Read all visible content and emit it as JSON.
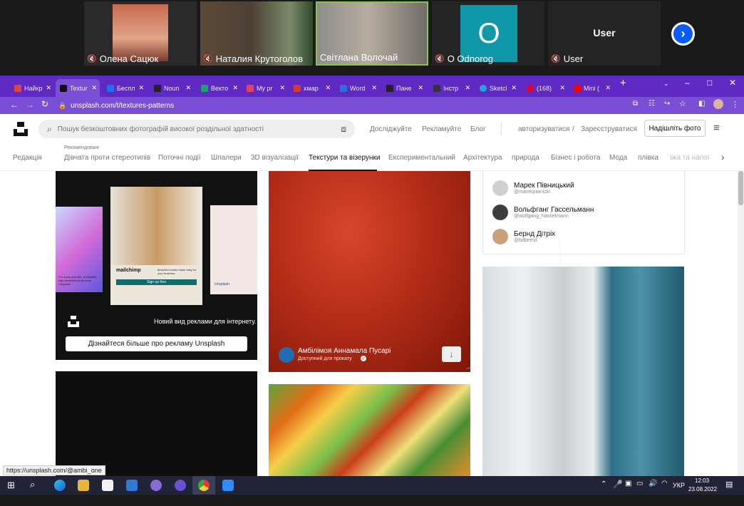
{
  "meeting": {
    "participants": [
      {
        "name": "Олена Сацюк",
        "muted": true,
        "avatar_color": "#b8543c"
      },
      {
        "name": "Наталия Крутоголов",
        "muted": true,
        "avatar_color": "#4a4035"
      },
      {
        "name": "Світлана Волочай",
        "muted": false,
        "avatar_color": "#8a8a86"
      },
      {
        "name": "O Odnorog",
        "muted": true,
        "avatar_letter": "O",
        "avatar_color": "#1098a8"
      },
      {
        "name": "User",
        "muted": true,
        "avatar_text": "User"
      }
    ]
  },
  "browser": {
    "tabs": [
      {
        "label": "Найкр",
        "favicon_color": "#e2433a"
      },
      {
        "label": "Textur",
        "favicon_color": "#111111",
        "active": true
      },
      {
        "label": "Беспл",
        "favicon_color": "#1a73e8"
      },
      {
        "label": "Noun",
        "favicon_color": "#222222"
      },
      {
        "label": "Векто",
        "favicon_color": "#1ca36b"
      },
      {
        "label": "My pr",
        "favicon_color": "#e2435b"
      },
      {
        "label": "хмар",
        "favicon_color": "#d83a2f"
      },
      {
        "label": "Word",
        "favicon_color": "#2a6fdb"
      },
      {
        "label": "Пане",
        "favicon_color": "#222222"
      },
      {
        "label": "Інстр",
        "favicon_color": "#333333"
      },
      {
        "label": "Sketcl",
        "favicon_color": "#1aa7e0"
      },
      {
        "label": "(168)",
        "favicon_color": "#e60023"
      },
      {
        "label": "Mini (",
        "favicon_color": "#ff0000"
      }
    ],
    "url": "unsplash.com/t/textures-patterns",
    "status_url": "https://unsplash.com/@ambi_one"
  },
  "unsplash": {
    "search_placeholder": "Пошук безкоштовних фотографій високої роздільної здатності",
    "nav": [
      "Досліджуйте",
      "Рекламуйте",
      "Блог"
    ],
    "login": "авторизуватися",
    "separator": "/",
    "signup": "Зареєструватися",
    "submit": "Надішліть фото",
    "recommended_label": "Рекомендовані",
    "categories": [
      "Редакція",
      "Дівчата проти стереотипів",
      "Поточні події",
      "Шпалери",
      "3D візуалізації",
      "Текстури та візерунки",
      "Експериментальний",
      "Архітектура",
      "природа",
      "Бізнес і робота",
      "Мода",
      "плівка",
      "їжа та напої"
    ],
    "active_category": "Текстури та візерунки"
  },
  "ad": {
    "tagline": "Новий вид реклами для інтернету.",
    "button": "Дізнайтеся більше про рекламу Unsplash",
    "mockup_brand": "mailchimp",
    "mockup_button": "Sign up free",
    "mockup_left_caption": "For every new site, a beautiful high resolution photo from Unsplash",
    "mockup_right_brand": "Unsplash",
    "mockup_mid_caption": "Beautiful emails made easy for your business"
  },
  "photo_card": {
    "author": "Амбілімоя Аннамала Пусарі",
    "availability": "Доступний для прокату"
  },
  "contributors": [
    {
      "name": "Марек Півницький",
      "handle": "@marekpiwnicki",
      "avatar_color": "#cfcfcf"
    },
    {
      "name": "Вольфганг Гассельманн",
      "handle": "@wolfgang_hasselmann",
      "avatar_color": "#3d3d3d"
    },
    {
      "name": "Бернд Дітріх",
      "handle": "@bdbernd",
      "avatar_color": "#c9a27a"
    }
  ],
  "taskbar": {
    "time": "12:03",
    "date": "23.08.2022",
    "language": "УКР"
  }
}
